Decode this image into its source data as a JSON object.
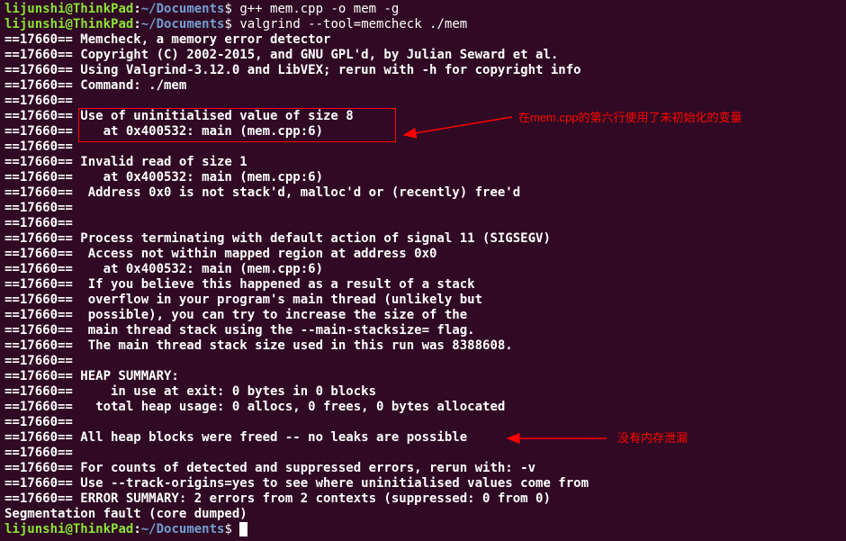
{
  "prompt1": {
    "user": "lijunshi",
    "at": "@",
    "host": "ThinkPad",
    "colon": ":",
    "path": "~/Documents",
    "dollar": "$ ",
    "cmd": "g++ mem.cpp -o mem -g"
  },
  "prompt2": {
    "user": "lijunshi",
    "at": "@",
    "host": "ThinkPad",
    "colon": ":",
    "path": "~/Documents",
    "dollar": "$ ",
    "cmd": "valgrind --tool=memcheck ./mem"
  },
  "lines": [
    "==17660== Memcheck, a memory error detector",
    "==17660== Copyright (C) 2002-2015, and GNU GPL'd, by Julian Seward et al.",
    "==17660== Using Valgrind-3.12.0 and LibVEX; rerun with -h for copyright info",
    "==17660== Command: ./mem",
    "==17660== ",
    "==17660== Use of uninitialised value of size 8",
    "==17660==    at 0x400532: main (mem.cpp:6)",
    "==17660== ",
    "==17660== Invalid read of size 1",
    "==17660==    at 0x400532: main (mem.cpp:6)",
    "==17660==  Address 0x0 is not stack'd, malloc'd or (recently) free'd",
    "==17660== ",
    "==17660== ",
    "==17660== Process terminating with default action of signal 11 (SIGSEGV)",
    "==17660==  Access not within mapped region at address 0x0",
    "==17660==    at 0x400532: main (mem.cpp:6)",
    "==17660==  If you believe this happened as a result of a stack",
    "==17660==  overflow in your program's main thread (unlikely but",
    "==17660==  possible), you can try to increase the size of the",
    "==17660==  main thread stack using the --main-stacksize= flag.",
    "==17660==  The main thread stack size used in this run was 8388608.",
    "==17660== ",
    "==17660== HEAP SUMMARY:",
    "==17660==     in use at exit: 0 bytes in 0 blocks",
    "==17660==   total heap usage: 0 allocs, 0 frees, 0 bytes allocated",
    "==17660== ",
    "==17660== All heap blocks were freed -- no leaks are possible",
    "==17660== ",
    "==17660== For counts of detected and suppressed errors, rerun with: -v",
    "==17660== Use --track-origins=yes to see where uninitialised values come from",
    "==17660== ERROR SUMMARY: 2 errors from 2 contexts (suppressed: 0 from 0)",
    "Segmentation fault (core dumped)"
  ],
  "prompt3": {
    "user": "lijunshi",
    "at": "@",
    "host": "ThinkPad",
    "colon": ":",
    "path": "~/Documents",
    "dollar": "$ "
  },
  "annotations": {
    "a1": "在mem.cpp的第六行使用了未初始化的变量",
    "a2": "没有内存泄漏"
  }
}
